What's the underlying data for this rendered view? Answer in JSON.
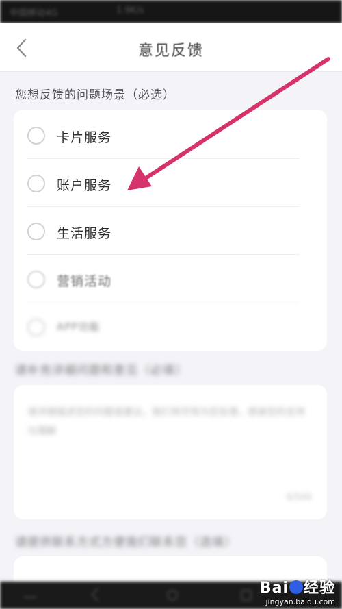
{
  "status_bar": {
    "carrier": "中国移动4G",
    "center": "1.9K/s",
    "right": ""
  },
  "header": {
    "title": "意见反馈"
  },
  "scenario_section": {
    "label": "您想反馈的问题场景（必选）",
    "options": [
      {
        "label": "卡片服务",
        "selected": false
      },
      {
        "label": "账户服务",
        "selected": false
      },
      {
        "label": "生活服务",
        "selected": false
      },
      {
        "label": "营销活动",
        "selected": false
      },
      {
        "label": "APP功能",
        "selected": false
      }
    ]
  },
  "description_section": {
    "label": "请补充详细问题和意见（必填）",
    "placeholder": "请详细描述您的问题或建议，我们将尽快为您处理，感谢您的支持与理解",
    "counter": "0/500"
  },
  "contact_section": {
    "label": "请提供联系方式方便我们联系您（选填）"
  },
  "watermark": {
    "brand_left": "Bai",
    "brand_right": "经验",
    "url": "jingyan.baidu.com"
  },
  "colors": {
    "annotation_arrow": "#d6336c",
    "background": "#f4f3f7"
  }
}
